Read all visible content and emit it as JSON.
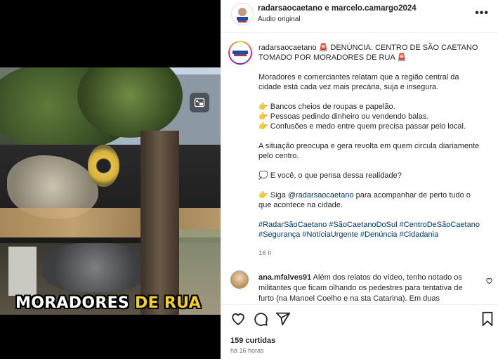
{
  "video": {
    "caption_white": "MORADORES",
    "caption_yellow": " DE RUA"
  },
  "header": {
    "title": "radarsaocaetano e marcelo.camargo2024",
    "subtitle": "Áudio original"
  },
  "post": {
    "username": "radarsaocaetano",
    "headline_emoji": "🚨",
    "headline": "DENÚNCIA: CENTRO DE SÃO CAETANO TOMADO POR MORADORES DE RUA",
    "paragraph1": "Moradores e comerciantes relatam que a região central da cidade está cada vez mais precária, suja e insegura.",
    "bullets": [
      {
        "emoji": "👉",
        "text": "Bancos cheios de roupas e papelão."
      },
      {
        "emoji": "👉",
        "text": "Pessoas pedindo dinheiro ou vendendo balas."
      },
      {
        "emoji": "👉",
        "text": "Confusões e medo entre quem precisa passar pelo local."
      }
    ],
    "paragraph2": "A situação preocupa e gera revolta em quem circula diariamente pelo centro.",
    "question_emoji": "💭",
    "question": "E você, o que pensa dessa realidade?",
    "follow_emoji": "👉",
    "follow_prefix": "Siga ",
    "follow_handle": "@radarsaocaetano",
    "follow_suffix": " para acompanhar de perto tudo o que acontece na cidade.",
    "hashtags": "#RadarSãoCaetano #SãoCaetanoDoSul #CentroDeSãoCaetano #Segurança #NotíciaUrgente #Denúncia #Cidadania",
    "time": "16 h"
  },
  "comment": {
    "username": "ana.mfalves91",
    "text": "Além dos relatos do vídeo, tenho notado os militantes que ficam olhando os pedestres para tentativa de furto (na Manoel Coelho e na sta Catarina). Em duas situações,"
  },
  "footer": {
    "likes": "159 curtidas",
    "when": "há 16 horas"
  }
}
